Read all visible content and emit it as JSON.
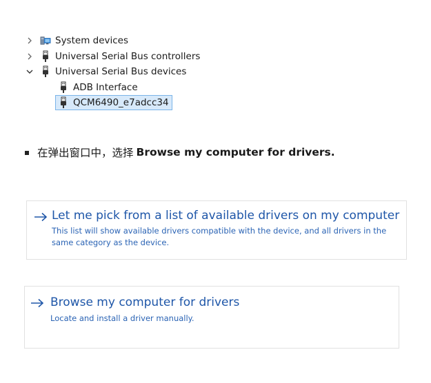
{
  "tree": {
    "items": [
      {
        "label": "System devices",
        "expanded": false,
        "icon": "system-devices-icon"
      },
      {
        "label": "Universal Serial Bus controllers",
        "expanded": false,
        "icon": "usb-icon"
      },
      {
        "label": "Universal Serial Bus devices",
        "expanded": true,
        "icon": "usb-icon"
      }
    ],
    "children": [
      {
        "label": "ADB Interface",
        "icon": "usb-icon",
        "selected": false
      },
      {
        "label": "QCM6490_e7adcc34",
        "icon": "usb-icon",
        "selected": true
      }
    ]
  },
  "instruction": {
    "prefix": "在弹出窗口中，选择",
    "bold": "Browse my computer for drivers."
  },
  "options": [
    {
      "title": "Let me pick from a list of available drivers on my computer",
      "description": "This list will show available drivers compatible with the device, and all drivers in the same category as the device.",
      "icon": "arrow-right-icon"
    },
    {
      "title": "Browse my computer for drivers",
      "description": "Locate and install a driver manually.",
      "icon": "arrow-right-icon"
    }
  ],
  "colors": {
    "link": "#1e56a8",
    "link_desc": "#2a63b4",
    "selection_bg": "#d7e9fa",
    "selection_border": "#7ab4e8",
    "panel_border": "#e1e1e1"
  }
}
